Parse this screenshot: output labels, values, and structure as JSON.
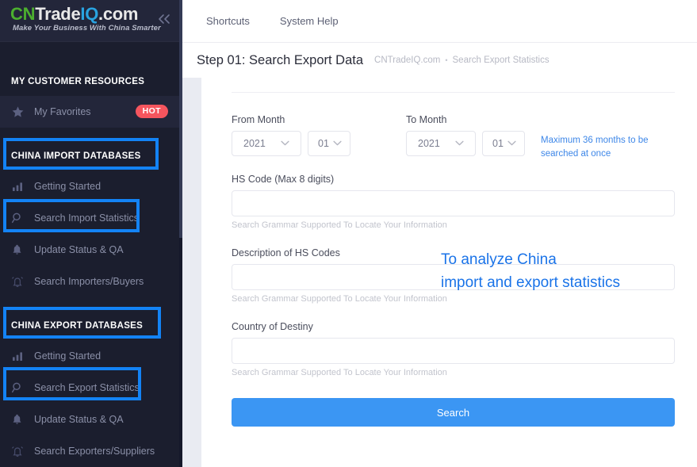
{
  "sidebar": {
    "logo": {
      "part_cn": "CN",
      "part_trade": "Trade",
      "part_iq": "IQ",
      "part_com": ".com",
      "tagline": "Make Your Business With China Smarter",
      "collapse_icon": "double-chevron-left-icon"
    },
    "sections": [
      {
        "title": "MY CUSTOMER RESOURCES",
        "items": [
          {
            "label": "My Favorites",
            "icon": "star-icon",
            "badge": "HOT"
          }
        ]
      },
      {
        "title": "CHINA IMPORT DATABASES",
        "items": [
          {
            "label": "Getting Started",
            "icon": "bar-chart-icon"
          },
          {
            "label": "Search Import Statistics",
            "icon": "search-icon"
          },
          {
            "label": "Update Status & QA",
            "icon": "bell-filled-icon"
          },
          {
            "label": "Search Importers/Buyers",
            "icon": "bell-ring-icon"
          }
        ]
      },
      {
        "title": "CHINA EXPORT DATABASES",
        "items": [
          {
            "label": "Getting Started",
            "icon": "bar-chart-icon"
          },
          {
            "label": "Search Export Statistics",
            "icon": "search-icon"
          },
          {
            "label": "Update Status & QA",
            "icon": "bell-filled-icon"
          },
          {
            "label": "Search Exporters/Suppliers",
            "icon": "bell-ring-icon"
          }
        ]
      }
    ]
  },
  "topnav": {
    "items": [
      {
        "label": "Shortcuts"
      },
      {
        "label": "System Help"
      }
    ]
  },
  "pagehead": {
    "title": "Step 01: Search Export Data",
    "breadcrumb_root": "CNTradeIQ.com",
    "breadcrumb_separator": "•",
    "breadcrumb_current": "Search Export Statistics"
  },
  "form": {
    "from_month": {
      "label": "From Month",
      "year_value": "2021",
      "month_value": "01",
      "caret_icon": "chevron-down-icon"
    },
    "to_month": {
      "label": "To Month",
      "year_value": "2021",
      "month_value": "01",
      "caret_icon": "chevron-down-icon"
    },
    "max_note_line1": "Maximum 36 months to be",
    "max_note_line2": "searched at once",
    "hs_code": {
      "label": "HS Code (Max 8 digits)",
      "value": "",
      "placeholder": "",
      "hint": "Search Grammar Supported To Locate Your Information"
    },
    "description": {
      "label": "Description of HS Codes",
      "value": "",
      "placeholder": "",
      "hint": "Search Grammar Supported To Locate Your Information"
    },
    "country": {
      "label": "Country of Destiny",
      "value": "",
      "placeholder": "",
      "hint": "Search Grammar Supported To Locate Your Information"
    },
    "search_button": "Search"
  },
  "annotation": {
    "line1": "To analyze China",
    "line2": "import and export statistics",
    "color": "#1a73e8"
  },
  "colors": {
    "sidebar_bg": "#1b1e2e",
    "highlight_blue": "#1383f5",
    "accent_blue": "#3b96f3",
    "hot_badge": "#f5555e",
    "logo_green": "#4caf2f",
    "logo_blue": "#29a3e0"
  }
}
